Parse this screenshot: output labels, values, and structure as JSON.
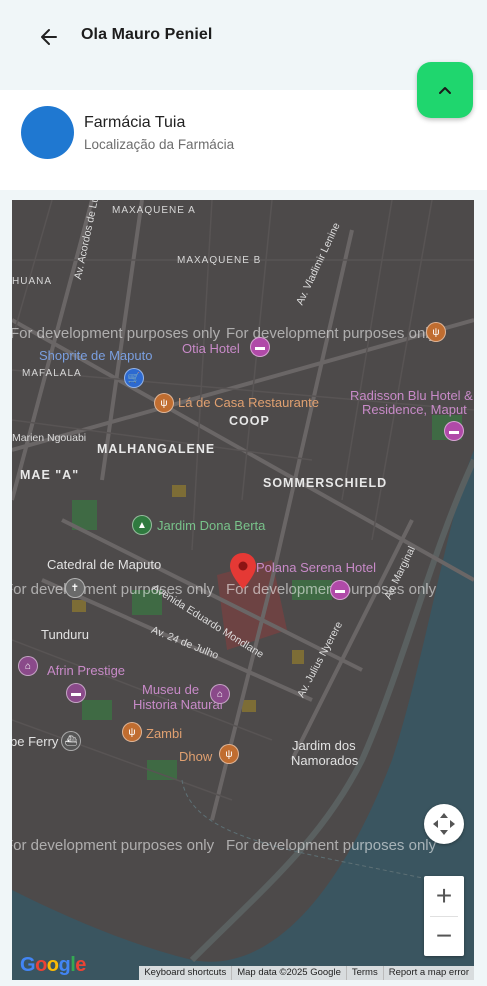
{
  "header": {
    "title": "Ola Mauro Peniel",
    "back_icon": "arrow-left-icon"
  },
  "pharmacy": {
    "name": "Farmácia Tuia",
    "subtitle": "Localização da Farmácia"
  },
  "fab": {
    "icon": "chevron-up-icon",
    "color": "#1fd66e"
  },
  "map": {
    "watermark": "For development purposes only",
    "areas": [
      "MAXAQUENE A",
      "MAXAQUENE B",
      "MAFALALA",
      "MALHANGALENE",
      "COOP",
      "SOMMERSCHIELD",
      "MAE \"A\"",
      "HUANA"
    ],
    "pois": [
      "Shoprite de Maputo",
      "Otia Hotel",
      "Lá de Casa Restaurante",
      "Radisson Blu Hotel &",
      "Residence, Maput",
      "Jardim Dona Berta",
      "Catedral de Maputo",
      "Polana Serena Hotel",
      "Tunduru",
      "Afrin Prestige",
      "Museu de",
      "Historia Natural",
      "Zambi",
      "Dhow",
      "Jardim dos",
      "Namorados",
      "be Ferry",
      "Marien Ngouabi"
    ],
    "streets": [
      "Av. Acordos de Lusaka",
      "Av. Vladimir Lenine",
      "Avenida Eduardo Mondlane",
      "Av. 24 de Julho",
      "Av. Julius Nyerere",
      "Av. Marginal"
    ],
    "logo": "Google",
    "attribution": [
      "Keyboard shortcuts",
      "Map data ©2025 Google",
      "Terms",
      "Report a map error"
    ],
    "controls": {
      "move_icon": "pan-arrows-icon",
      "zoom_in": "+",
      "zoom_out": "−"
    }
  }
}
